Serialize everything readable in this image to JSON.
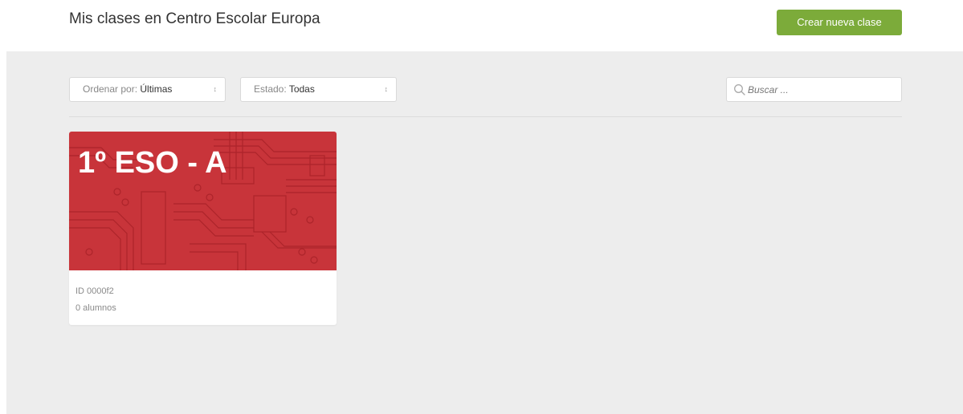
{
  "header": {
    "title": "Mis clases en Centro Escolar Europa",
    "create_button": "Crear nueva clase"
  },
  "filters": {
    "sort_label": "Ordenar por:",
    "sort_value": "Últimas",
    "status_label": "Estado:",
    "status_value": "Todas",
    "search_placeholder": "Buscar ..."
  },
  "classes": [
    {
      "name": "1º ESO - A",
      "id": "ID 0000f2",
      "students": "0 alumnos",
      "banner_color": "#c8343a"
    }
  ],
  "colors": {
    "accent": "#7cab3a",
    "background": "#ededed"
  },
  "icons": {
    "search": "search-icon",
    "select_arrows": "chevron-up-down-icon"
  }
}
